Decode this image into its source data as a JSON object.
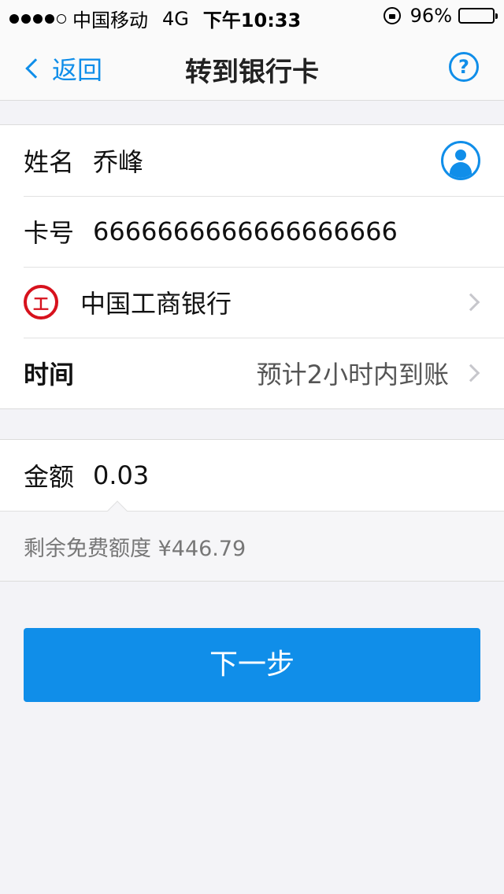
{
  "status_bar": {
    "carrier": "中国移动",
    "network": "4G",
    "time": "下午10:33",
    "battery": "96%",
    "signal_bars": 4,
    "signal_total": 5
  },
  "nav": {
    "back_label": "返回",
    "title": "转到银行卡",
    "help_label": "?"
  },
  "form": {
    "name_label": "姓名",
    "name_value": "乔峰",
    "card_label": "卡号",
    "card_value": "6666666666666666666",
    "bank_name": "中国工商银行",
    "bank_logo_text": "工",
    "time_label": "时间",
    "time_value": "预计2小时内到账",
    "amount_label": "金额",
    "amount_value": "0.03",
    "quota_text": "剩余免费额度 ¥446.79"
  },
  "actions": {
    "next_label": "下一步"
  },
  "colors": {
    "accent": "#108ee9",
    "bank_red": "#d7121d",
    "background": "#f3f3f7"
  }
}
